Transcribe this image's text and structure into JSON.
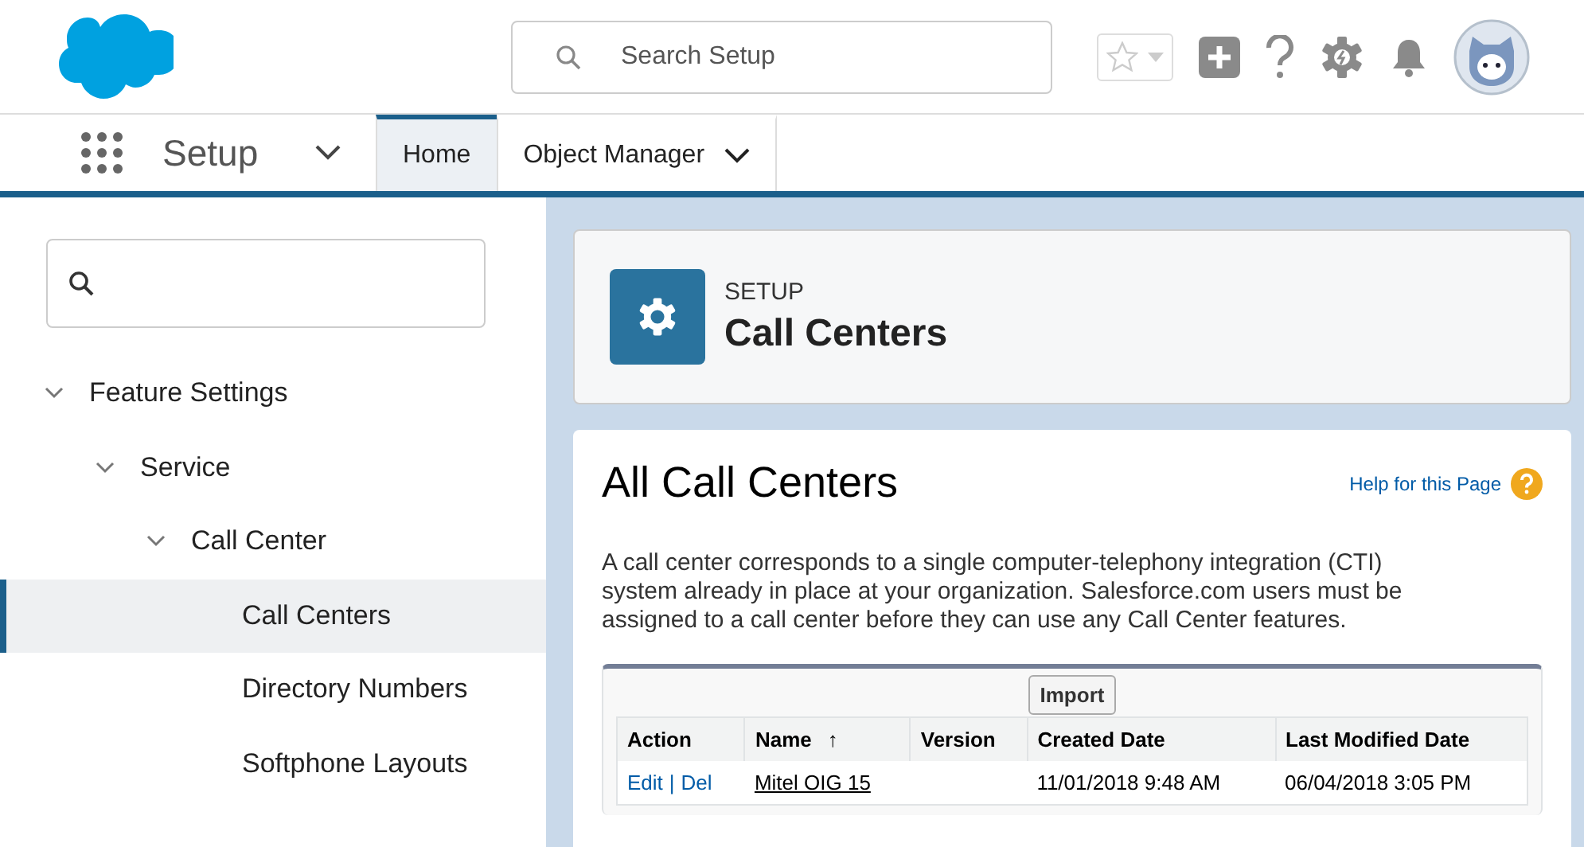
{
  "header": {
    "search": {
      "placeholder": "Search Setup"
    }
  },
  "nav": {
    "app_name": "Setup",
    "tabs": [
      {
        "label": "Home",
        "selected": true,
        "has_menu": false
      },
      {
        "label": "Object Manager",
        "selected": false,
        "has_menu": true
      }
    ]
  },
  "sidebar": {
    "tree": [
      {
        "label": "Feature Settings",
        "expanded": true,
        "selected": false,
        "children": [
          {
            "label": "Service",
            "expanded": true,
            "selected": false,
            "children": [
              {
                "label": "Call Center",
                "expanded": true,
                "selected": false,
                "children": [
                  {
                    "label": "Call Centers",
                    "selected": true
                  },
                  {
                    "label": "Directory Numbers",
                    "selected": false
                  },
                  {
                    "label": "Softphone Layouts",
                    "selected": false
                  }
                ]
              }
            ]
          }
        ]
      }
    ]
  },
  "page_header": {
    "eyebrow": "SETUP",
    "title": "Call Centers"
  },
  "content": {
    "title": "All Call Centers",
    "help_link": "Help for this Page",
    "description": "A call center corresponds to a single computer-telephony integration (CTI) system already in place at your organization. Salesforce.com users must be assigned to a call center before they can use any Call Center features.",
    "import_button": "Import",
    "table": {
      "columns": [
        {
          "label": "Action"
        },
        {
          "label": "Name",
          "sort": "↑"
        },
        {
          "label": "Version"
        },
        {
          "label": "Created Date"
        },
        {
          "label": "Last Modified Date"
        }
      ],
      "rows": [
        {
          "actions": [
            "Edit",
            "Del"
          ],
          "separator": "|",
          "name": "Mitel OIG 15",
          "created": "11/01/2018 9:48 AM",
          "modified": "06/04/2018 3:05 PM"
        }
      ]
    }
  }
}
